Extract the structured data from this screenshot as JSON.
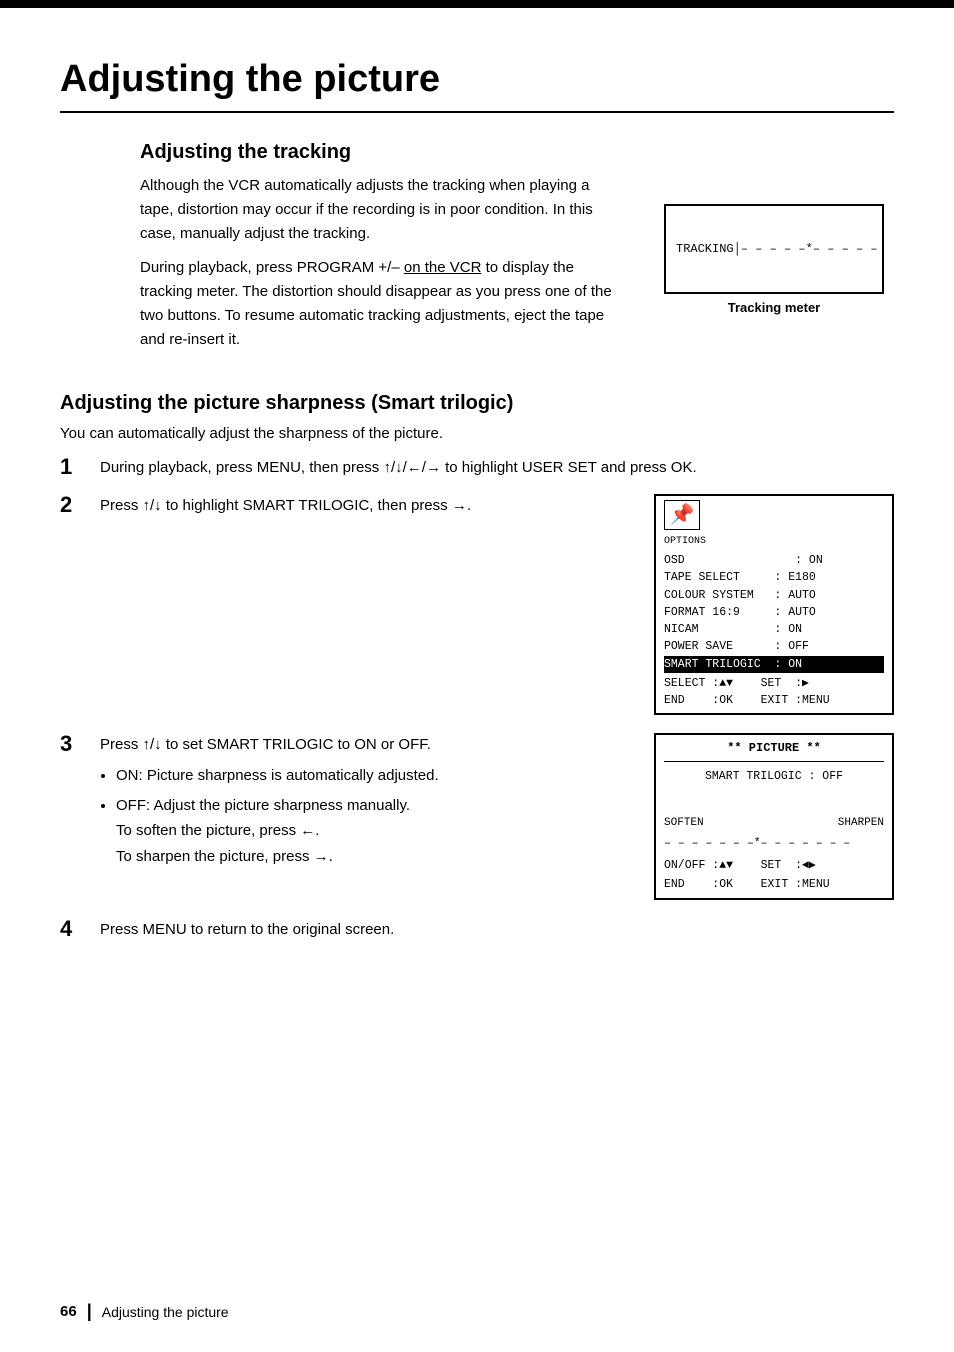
{
  "page": {
    "title": "Adjusting the picture",
    "top_border": true
  },
  "tracking_section": {
    "heading": "Adjusting the tracking",
    "para1": "Although the VCR automatically adjusts the tracking when playing a tape, distortion may occur if the recording is in poor condition.  In this case, manually adjust the tracking.",
    "para2_pre": "During playback, press PROGRAM +/–",
    "para2_underline": "on the VCR",
    "para2_post": "to display the tracking meter.  The distortion should disappear as you press one of the two buttons.  To resume automatic tracking adjustments, eject the tape and re-insert it.",
    "tracking_display": "TRACKING|– – – – – * – – – – –",
    "tracking_meter_label": "Tracking meter"
  },
  "smart_section": {
    "heading": "Adjusting the picture sharpness (Smart trilogic)",
    "intro": "You can automatically adjust the sharpness of the picture.",
    "step1_num": "1",
    "step1_text": "During playback, press MENU, then press ↑/↓/←/→ to highlight USER SET and press OK.",
    "step2_num": "2",
    "step2_text_pre": "Press",
    "step2_text_arrows": "↑/↓",
    "step2_text_post": "to highlight SMART TRILOGIC, then press →.",
    "menu_screen": {
      "icon_label": "OPTIONS",
      "rows": [
        {
          "label": "OSD",
          "value": ": ON"
        },
        {
          "label": "TAPE SELECT",
          "value": ": E180"
        },
        {
          "label": "COLOUR SYSTEM",
          "value": ": AUTO"
        },
        {
          "label": "FORMAT 16:9",
          "value": ": AUTO"
        },
        {
          "label": "NICAM",
          "value": ": ON"
        },
        {
          "label": "POWER SAVE",
          "value": ": OFF"
        },
        {
          "label": "SMART TRILOGIC",
          "value": ": ON",
          "highlighted": true
        }
      ],
      "footer": [
        "SELECT : ▲▼    SET  : ▶",
        "END    : OK    EXIT : MENU"
      ]
    },
    "step3_num": "3",
    "step3_text_pre": "Press",
    "step3_text_arrows": "↑/↓",
    "step3_text_post": "to set SMART TRILOGIC to ON or OFF.",
    "bullet_on": "ON: Picture sharpness is automatically adjusted.",
    "bullet_off_pre": "OFF: Adjust the picture sharpness manually.",
    "soften_text": "To soften the picture, press ←.",
    "sharpen_text": "To sharpen the picture, press →.",
    "picture_screen": {
      "title": "** PICTURE **",
      "smart_row": "SMART TRILOGIC : OFF",
      "soften": "SOFTEN",
      "sharpen": "SHARPEN",
      "slider": "– – – – – – – – – *– – – – – – – – –",
      "footer": [
        "ON/OFF : ▲▼    SET  : ◄▶",
        "END    : OK    EXIT : MENU"
      ]
    },
    "step4_num": "4",
    "step4_text": "Press MENU to return to the original screen."
  },
  "footer": {
    "page_num": "66",
    "label": "Adjusting the picture"
  }
}
